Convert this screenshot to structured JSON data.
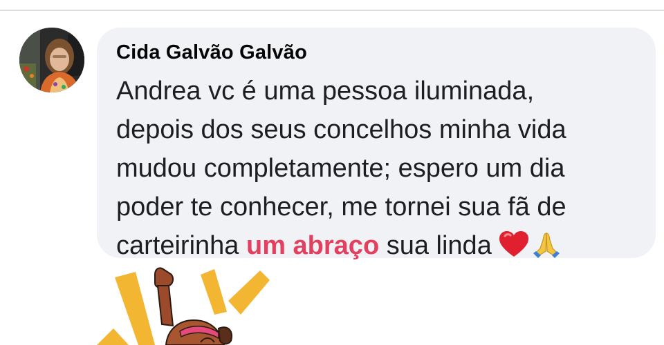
{
  "comment": {
    "author": "Cida Galvão Galvão",
    "lines": [
      "Andrea vc é uma pessoa iluminada,",
      "depois dos seus concelhos minha vida",
      "mudou completamente; espero um dia",
      "poder te conhecer, me tornei sua fã de"
    ],
    "last_line_before": "carteirinha ",
    "last_line_highlight": "um abraço",
    "last_line_after": " sua linda",
    "emojis": [
      "heart-icon",
      "folded-hands-icon"
    ],
    "highlight_color": "#e3405f",
    "bubble_color": "#f0f2f5"
  },
  "sticker": {
    "icon": "celebrating-person-sticker"
  }
}
